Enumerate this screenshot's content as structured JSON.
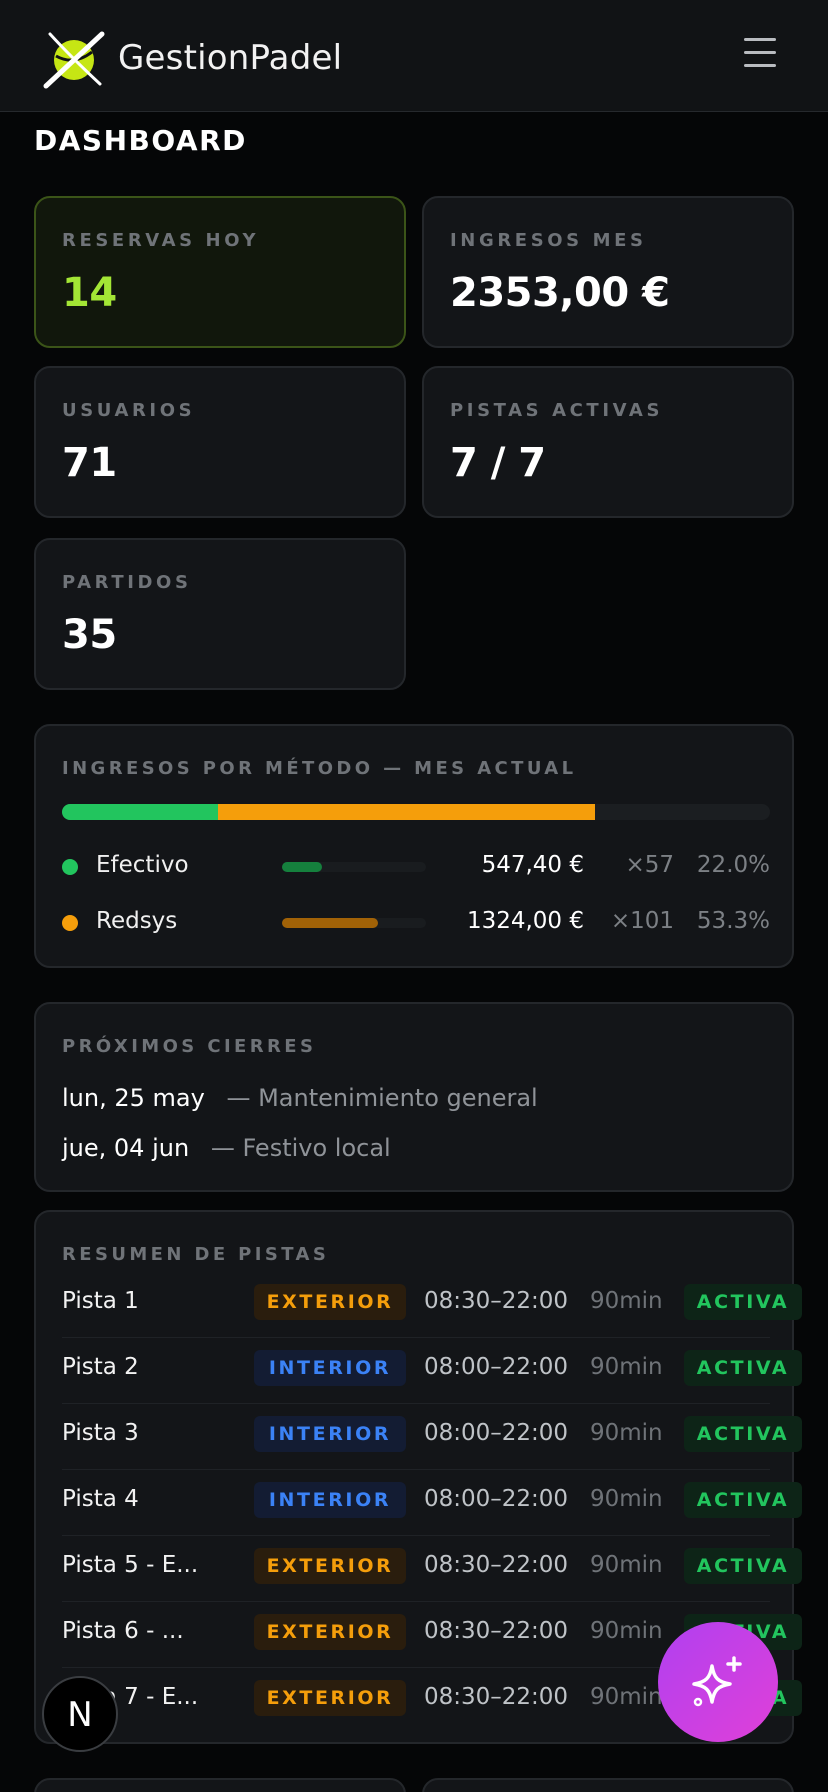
{
  "header": {
    "brand": "GestionPadel",
    "logo_icon": "padel-ball-logo-icon",
    "menu_icon": "hamburger-menu-icon"
  },
  "page_title": "DASHBOARD",
  "stats": [
    {
      "label": "RESERVAS HOY",
      "value": "14"
    },
    {
      "label": "INGRESOS MES",
      "value": "2353,00 €"
    },
    {
      "label": "USUARIOS",
      "value": "71"
    },
    {
      "label": "PISTAS ACTIVAS",
      "value": "7 / 7"
    },
    {
      "label": "PARTIDOS",
      "value": "35"
    }
  ],
  "income_by_method": {
    "title": "INGRESOS POR MÉTODO — MES ACTUAL",
    "methods": [
      {
        "name": "Efectivo",
        "amount": "547,40 €",
        "count": "×57",
        "pct": "22.0%",
        "share": 0.22,
        "color": "#22c55e",
        "mini_color": "#15803d"
      },
      {
        "name": "Redsys",
        "amount": "1324,00 €",
        "count": "×101",
        "pct": "53.3%",
        "share": 0.533,
        "color": "#f59e0b",
        "mini_color": "#a16207"
      }
    ]
  },
  "closures": {
    "title": "PRÓXIMOS CIERRES",
    "items": [
      {
        "date": "lun, 25 may",
        "reason": "— Mantenimiento general"
      },
      {
        "date": "jue, 04 jun",
        "reason": "— Festivo local"
      }
    ]
  },
  "courts": {
    "title": "RESUMEN DE PISTAS",
    "rows": [
      {
        "name": "Pista 1",
        "type": "EXTERIOR",
        "hours": "08:30–22:00",
        "slot": "90min",
        "status": "ACTIVA"
      },
      {
        "name": "Pista 2",
        "type": "INTERIOR",
        "hours": "08:00–22:00",
        "slot": "90min",
        "status": "ACTIVA"
      },
      {
        "name": "Pista 3",
        "type": "INTERIOR",
        "hours": "08:00–22:00",
        "slot": "90min",
        "status": "ACTIVA"
      },
      {
        "name": "Pista 4",
        "type": "INTERIOR",
        "hours": "08:00–22:00",
        "slot": "90min",
        "status": "ACTIVA"
      },
      {
        "name": "Pista 5 - E...",
        "type": "EXTERIOR",
        "hours": "08:30–22:00",
        "slot": "90min",
        "status": "ACTIVA"
      },
      {
        "name": "Pista 6 - ...",
        "type": "EXTERIOR",
        "hours": "08:30–22:00",
        "slot": "90min",
        "status": "ACTIVA"
      },
      {
        "name": "Pista 7 - E...",
        "type": "EXTERIOR",
        "hours": "08:30–22:00",
        "slot": "90min",
        "status": "ACTIVA"
      }
    ]
  },
  "fab": {
    "icon": "sparkles-icon"
  },
  "dev_badge": {
    "label": "N",
    "icon": "nextjs-logo-icon"
  }
}
